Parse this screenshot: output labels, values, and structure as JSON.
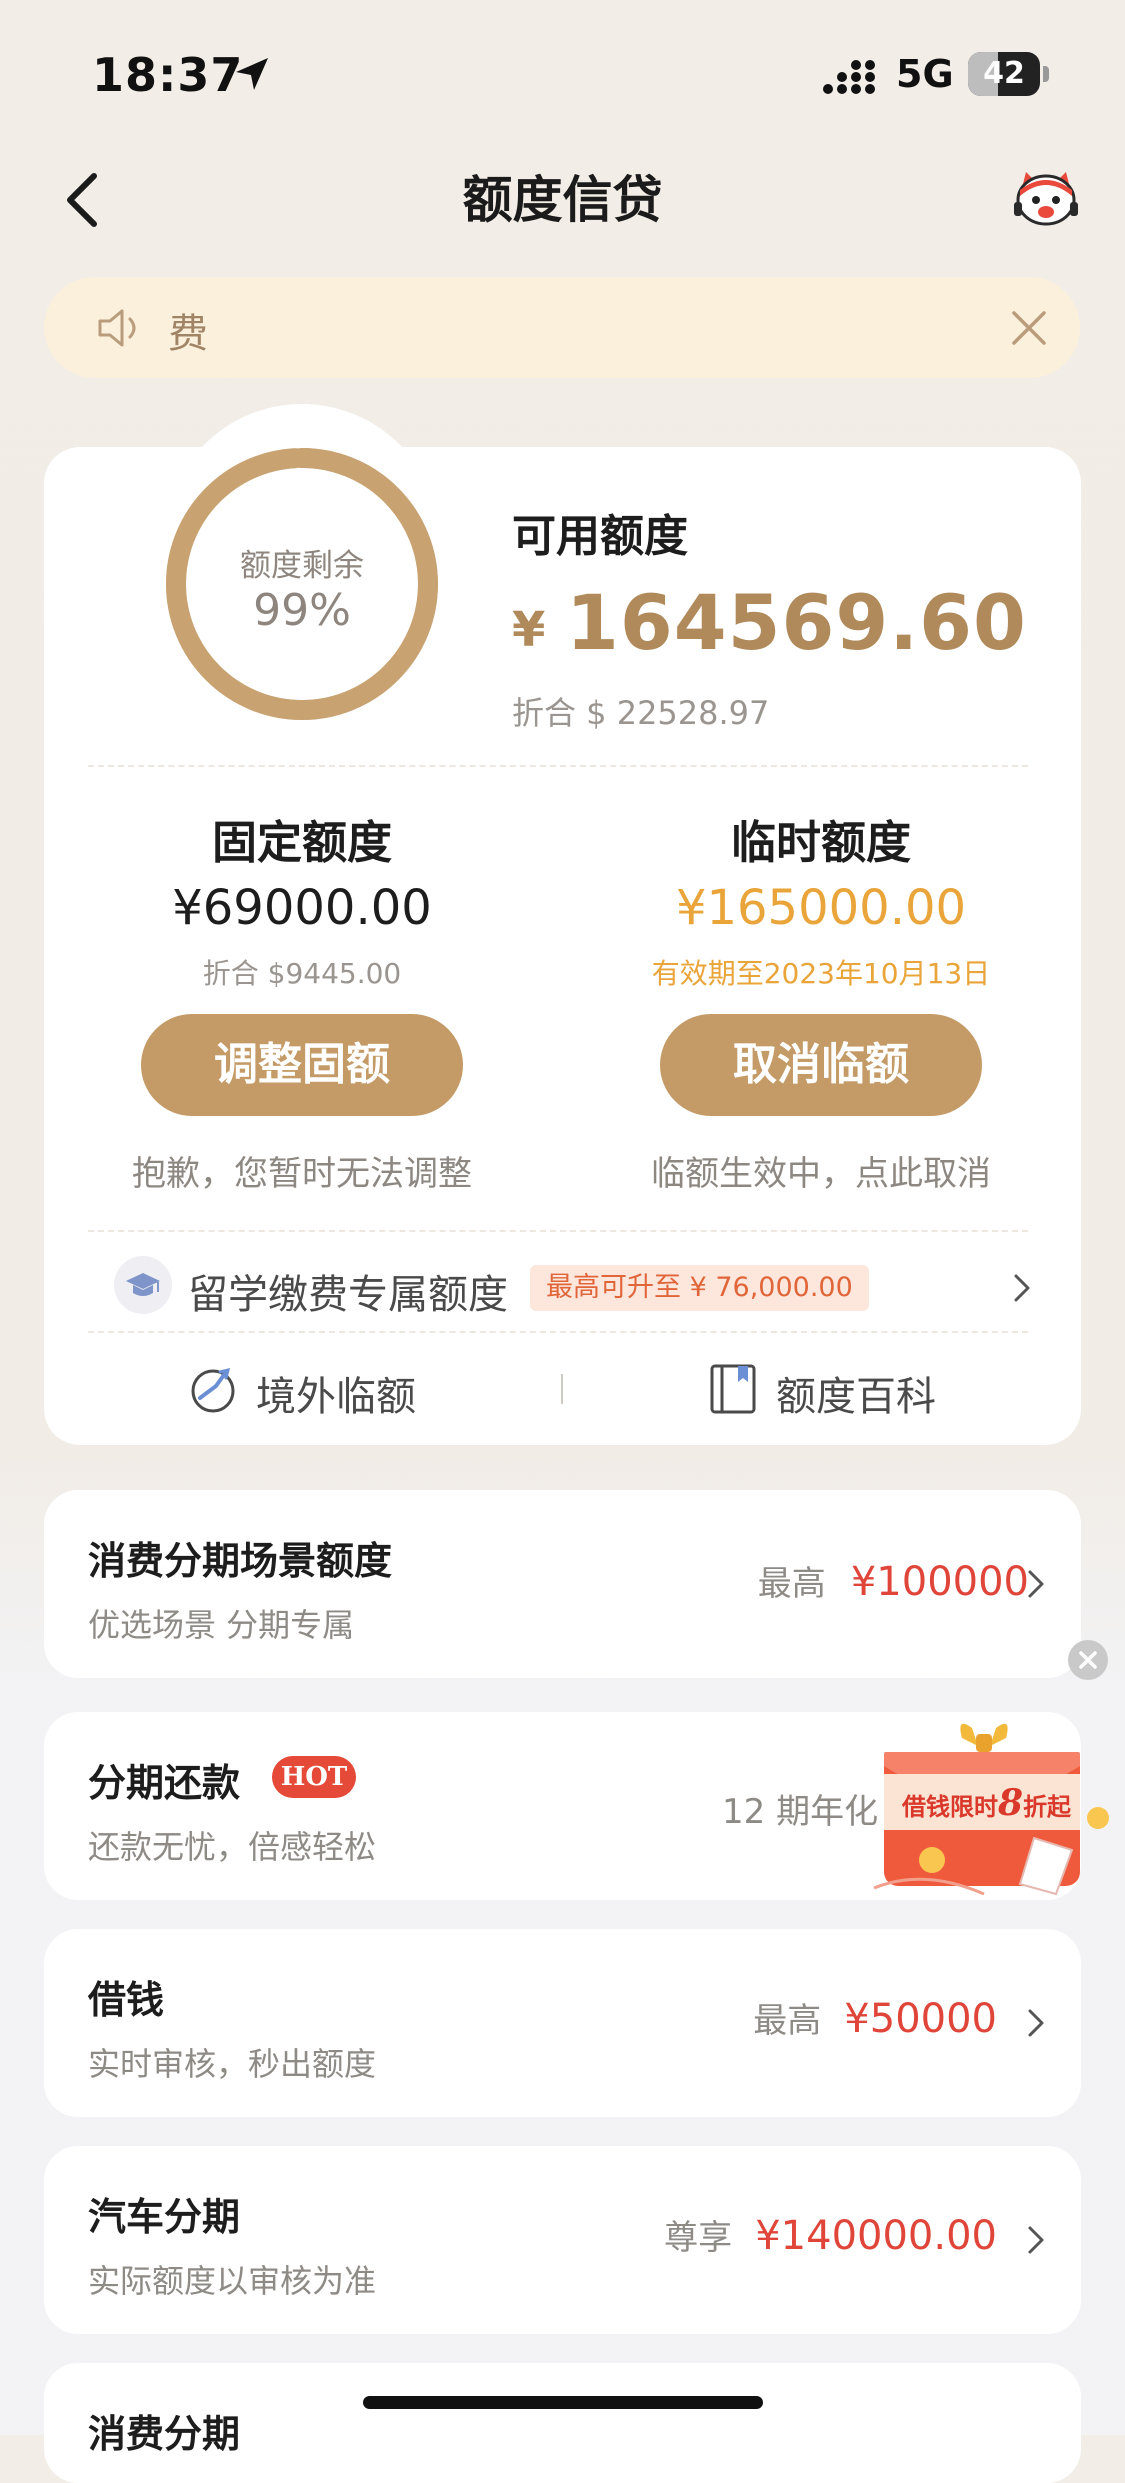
{
  "status_bar": {
    "time": "18:37",
    "network": "5G",
    "battery_level": "42"
  },
  "header": {
    "title": "额度信贷"
  },
  "notice": {
    "text": "费"
  },
  "quota": {
    "ring_label": "额度剩余",
    "ring_percent": "99%",
    "ring_fraction": 0.99,
    "available_label": "可用额度",
    "currency_symbol": "¥",
    "available_amount": "164569.60",
    "available_usd": "折合 $ 22528.97"
  },
  "fixed": {
    "title": "固定额度",
    "amount": "¥69000.00",
    "usd": "折合 $9445.00",
    "button": "调整固额",
    "note": "抱歉，您暂时无法调整"
  },
  "temp": {
    "title": "临时额度",
    "amount": "¥165000.00",
    "validity": "有效期至2023年10月13日",
    "button": "取消临额",
    "note": "临额生效中，点此取消"
  },
  "study": {
    "label": "留学缴费专属额度",
    "badge": "最高可升至 ¥ 76,000.00"
  },
  "quick_links": {
    "overseas": "境外临额",
    "wiki": "额度百科"
  },
  "products": [
    {
      "title": "消费分期场景额度",
      "subtitle": "优选场景 分期专属",
      "prefix": "最高",
      "amount": "¥100000"
    },
    {
      "title": "分期还款",
      "badge": "HOT",
      "subtitle": "还款无忧，倍感轻松",
      "prefix": "12 期年化"
    },
    {
      "title": "借钱",
      "subtitle": "实时审核，秒出额度",
      "prefix": "最高",
      "amount": "¥50000"
    },
    {
      "title": "汽车分期",
      "subtitle": "实际额度以审核为准",
      "prefix": "尊享",
      "amount": "¥140000.00"
    },
    {
      "title": "消费分期"
    }
  ],
  "promo": {
    "text_a": "借钱限时",
    "text_b": "8",
    "text_c": "折起"
  },
  "colors": {
    "gold": "#c49b67",
    "amount_gold": "#b08a5a",
    "temp_orange": "#e9a43a",
    "red": "#e0453a",
    "bg": "#f2ede6"
  }
}
